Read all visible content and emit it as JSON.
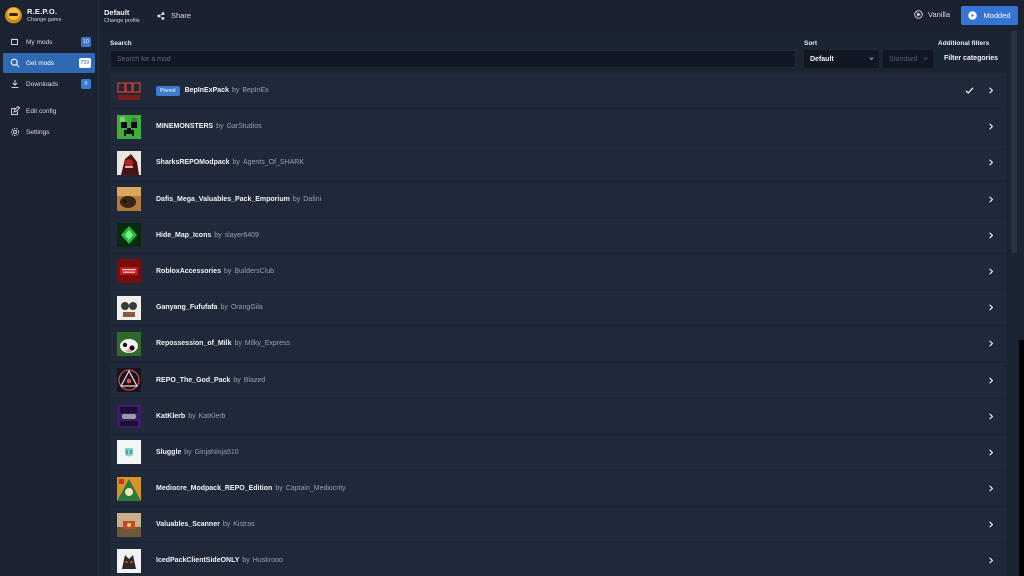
{
  "game": {
    "title": "R.E.P.O.",
    "subtitle": "Change game"
  },
  "sidebar": {
    "items": [
      {
        "label": "My mods",
        "badge": "10",
        "icon": "puzzle-icon",
        "active": false
      },
      {
        "label": "Get mods",
        "badge": "739",
        "icon": "search-icon",
        "active": true
      },
      {
        "label": "Downloads",
        "badge": "0",
        "icon": "download-icon",
        "active": false
      },
      {
        "label": "Edit config",
        "icon": "edit-icon",
        "active": false
      },
      {
        "label": "Settings",
        "icon": "gear-icon",
        "active": false
      }
    ]
  },
  "topbar": {
    "profile_name": "Default",
    "profile_sub": "Change profile",
    "share_label": "Share",
    "vanilla_label": "Vanilla",
    "modded_label": "Modded"
  },
  "filters": {
    "search_label": "Search",
    "search_placeholder": "Search for a mod",
    "sort_label": "Sort",
    "sort_value": "Default",
    "direction_value": "Standard",
    "additional_label": "Additional filters",
    "categories_label": "Filter categories"
  },
  "mods": [
    {
      "name": "BepInExPack",
      "by": "by",
      "author": "BepInEx",
      "pinned": "Pinned",
      "installed": true
    },
    {
      "name": "MINEMONSTERS",
      "by": "by",
      "author": "GarStudios"
    },
    {
      "name": "SharksREPOModpack",
      "by": "by",
      "author": "Agents_Of_SHARK"
    },
    {
      "name": "Dafis_Mega_Valuables_Pack_Emporium",
      "by": "by",
      "author": "Dafini"
    },
    {
      "name": "Hide_Map_Icons",
      "by": "by",
      "author": "slayer6409"
    },
    {
      "name": "RobloxAccessories",
      "by": "by",
      "author": "BuildersClub"
    },
    {
      "name": "Ganyang_Fufufafa",
      "by": "by",
      "author": "OrangGila"
    },
    {
      "name": "Repossession_of_Milk",
      "by": "by",
      "author": "Milky_Express"
    },
    {
      "name": "REPO_The_God_Pack",
      "by": "by",
      "author": "Blazed"
    },
    {
      "name": "KatKlerb",
      "by": "by",
      "author": "KatKlerb"
    },
    {
      "name": "Sluggle",
      "by": "by",
      "author": "GinjaNinja510"
    },
    {
      "name": "Mediocre_Modpack_REPO_Edition",
      "by": "by",
      "author": "Captain_Mediocrity"
    },
    {
      "name": "Valuables_Scanner",
      "by": "by",
      "author": "Kistras"
    },
    {
      "name": "IcedPackClientSideONLY",
      "by": "by",
      "author": "Huskrooo"
    }
  ],
  "colors": {
    "accent": "#3674d4",
    "background": "#1b2433",
    "row": "#1f2939"
  }
}
